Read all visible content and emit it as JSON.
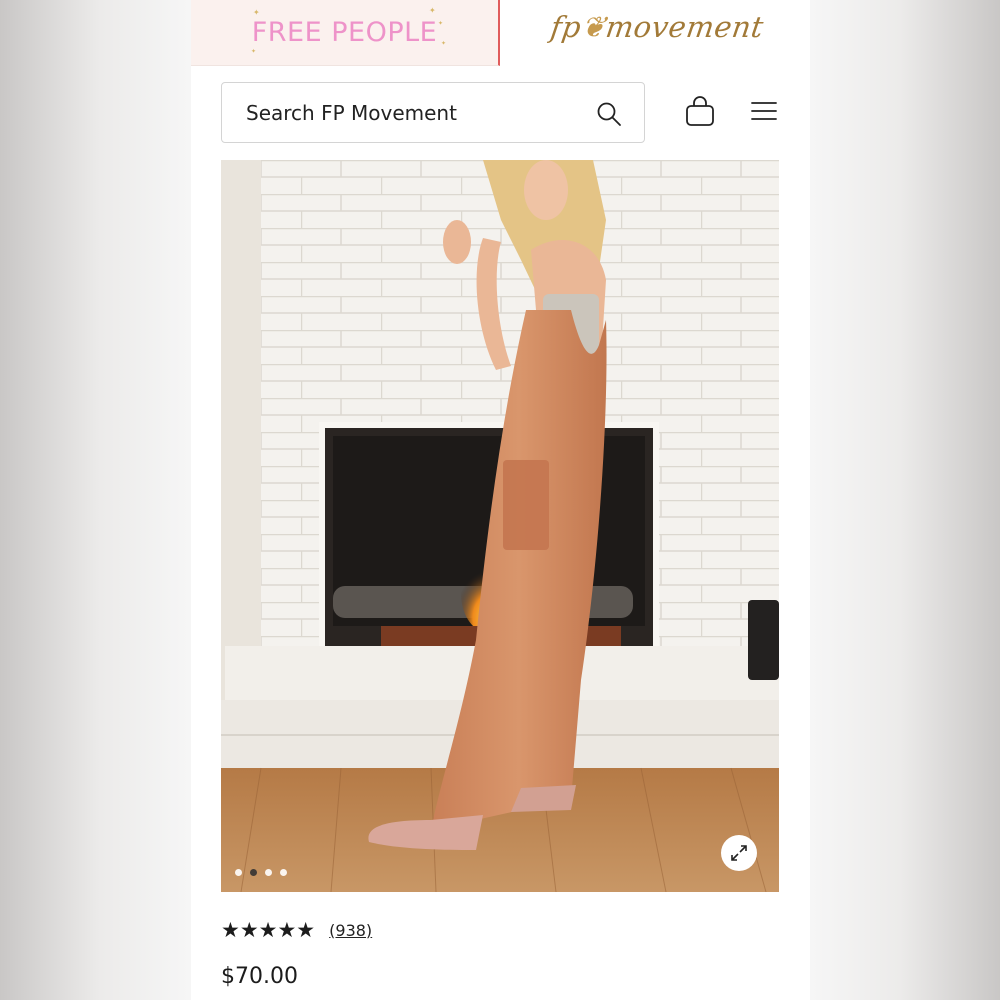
{
  "brand_tabs": {
    "free_people": "FREE PEOPLE",
    "fp_movement_logo": "fp movement"
  },
  "search": {
    "placeholder": "Search FP Movement"
  },
  "header_icons": {
    "search": "search-icon",
    "bag": "shopping-bag-icon",
    "menu": "hamburger-menu-icon"
  },
  "product": {
    "image_alt": "Model wearing terracotta jumpsuit by a white brick fireplace",
    "carousel": {
      "total": 4,
      "active_index": 1
    },
    "rating": {
      "stars": "★★★★★",
      "value": 5,
      "max": 5,
      "review_count": "(938)"
    },
    "price": "$70.00"
  },
  "colors": {
    "fp_tab_background": "#fbf1ee",
    "fp_tab_text": "#ee93c9",
    "active_tab_divider": "#e05c5c",
    "movement_logo": "#a27a38",
    "text": "#1c1c1c"
  }
}
